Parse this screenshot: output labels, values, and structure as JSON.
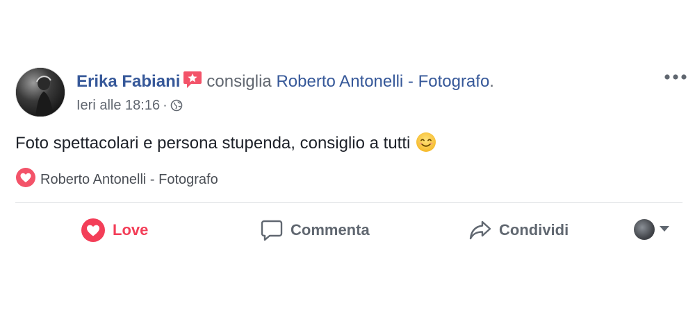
{
  "post": {
    "author": "Erika Fabiani",
    "verb": "consiglia",
    "page_name": "Roberto Antonelli - Fotografo",
    "period": ".",
    "timestamp": "Ieri alle 18:16",
    "separator": "·",
    "privacy_icon": "globe-icon",
    "text": "Foto spettacolari e persona stupenda, consiglio a tutti",
    "emoji": "smiling-face-emoji",
    "recommended_page": "Roberto Antonelli - Fotografo"
  },
  "actions": {
    "love_label": "Love",
    "comment_label": "Comment­a",
    "share_label": "Condividi"
  },
  "colors": {
    "link": "#365899",
    "love": "#f33e58",
    "secondary": "#616770"
  }
}
